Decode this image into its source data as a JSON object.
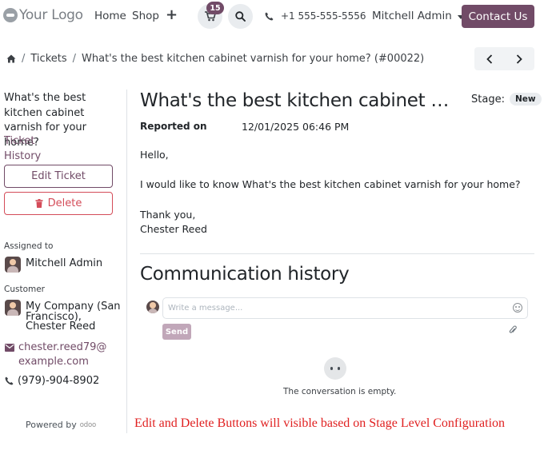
{
  "header": {
    "logo_text": "Your Logo",
    "nav": {
      "home": "Home",
      "shop": "Shop",
      "add_icon": "plus-icon"
    },
    "cart_count": "15",
    "phone": "+1 555-555-5556",
    "user": "Mitchell Admin",
    "contact_button": "Contact Us"
  },
  "breadcrumb": {
    "tickets": "Tickets",
    "current": "What's the best kitchen cabinet varnish for your home? (#00022)"
  },
  "sidebar": {
    "ticket_title": "What's the best kitchen cabinet varnish for your home?",
    "ticket_link": "Ticket",
    "history_link": "History",
    "edit_button": "Edit Ticket",
    "delete_button": "Delete",
    "assigned_label": "Assigned to",
    "assigned_name": "Mitchell Admin",
    "customer_label": "Customer",
    "customer_company": "My Company (San Francisco),",
    "customer_name": "Chester Reed",
    "email": "chester.reed79@example.com",
    "phone": "(979)-904-8902",
    "powered_by": "Powered by",
    "powered_brand": "odoo"
  },
  "ticket": {
    "title": "What's the best kitchen cabinet …",
    "stage_label": "Stage:",
    "stage_value": "New",
    "reported_label": "Reported on",
    "reported_value": "12/01/2025 06:46 PM",
    "greeting": "Hello,",
    "body": "I would like to know What's the best kitchen cabinet varnish for your home?",
    "signoff_1": "Thank you,",
    "signoff_2": "Chester Reed"
  },
  "communication": {
    "title": "Communication history",
    "placeholder": "Write a message...",
    "send": "Send",
    "empty": "The conversation is empty."
  },
  "note": "Edit and Delete Buttons will visible based on Stage Level Configuration",
  "colors": {
    "brand": "#714b67",
    "danger": "#d44c59",
    "note": "#e02020"
  }
}
